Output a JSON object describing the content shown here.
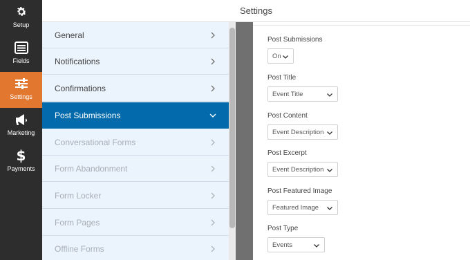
{
  "rail": {
    "items": [
      {
        "label": "Setup",
        "icon": "gear-icon"
      },
      {
        "label": "Fields",
        "icon": "list-icon"
      },
      {
        "label": "Settings",
        "icon": "sliders-icon"
      },
      {
        "label": "Marketing",
        "icon": "megaphone-icon"
      },
      {
        "label": "Payments",
        "icon": "dollar-icon"
      }
    ],
    "active_color": "#e27730"
  },
  "header": {
    "title": "Settings"
  },
  "menu": {
    "items": [
      {
        "label": "General"
      },
      {
        "label": "Notifications"
      },
      {
        "label": "Confirmations"
      },
      {
        "label": "Post Submissions"
      },
      {
        "label": "Conversational Forms"
      },
      {
        "label": "Form Abandonment"
      },
      {
        "label": "Form Locker"
      },
      {
        "label": "Form Pages"
      },
      {
        "label": "Offline Forms"
      }
    ],
    "active_color": "#036aab"
  },
  "form": {
    "post_submissions": {
      "label": "Post Submissions",
      "value": "On"
    },
    "post_title": {
      "label": "Post Title",
      "value": "Event Title"
    },
    "post_content": {
      "label": "Post Content",
      "value": "Event Description"
    },
    "post_excerpt": {
      "label": "Post Excerpt",
      "value": "Event Description"
    },
    "post_featured_image": {
      "label": "Post Featured Image",
      "value": "Featured Image"
    },
    "post_type": {
      "label": "Post Type",
      "value": "Events"
    }
  }
}
